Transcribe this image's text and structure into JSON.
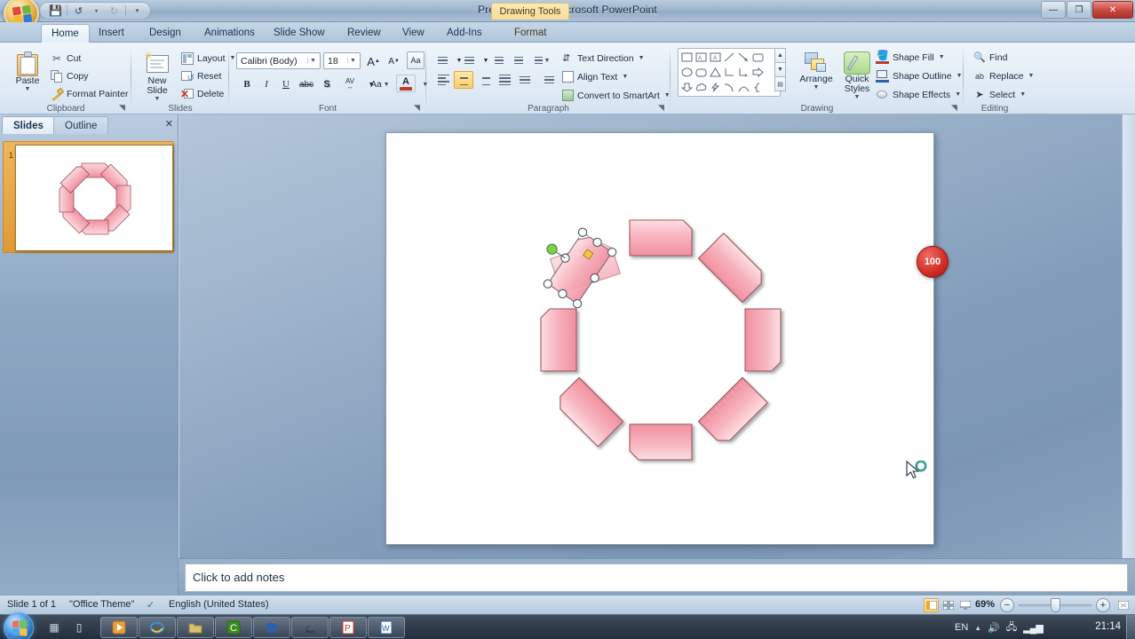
{
  "window": {
    "title": "Presentation2 - Microsoft PowerPoint",
    "contextual_tab_group": "Drawing Tools",
    "minimize": "—",
    "restore": "❐",
    "close": "✕"
  },
  "quick_access": {
    "save": "save-icon",
    "undo": "undo-icon",
    "redo": "redo-icon",
    "customize": "customize-icon"
  },
  "tabs": [
    {
      "label": "Home",
      "active": true
    },
    {
      "label": "Insert",
      "active": false
    },
    {
      "label": "Design",
      "active": false
    },
    {
      "label": "Animations",
      "active": false
    },
    {
      "label": "Slide Show",
      "active": false
    },
    {
      "label": "Review",
      "active": false
    },
    {
      "label": "View",
      "active": false
    },
    {
      "label": "Add-Ins",
      "active": false
    },
    {
      "label": "Format",
      "active": false,
      "contextual": true
    }
  ],
  "ribbon": {
    "clipboard": {
      "title": "Clipboard",
      "paste": "Paste",
      "cut": "Cut",
      "copy": "Copy",
      "format_painter": "Format Painter"
    },
    "slides": {
      "title": "Slides",
      "new_slide": "New Slide",
      "layout": "Layout",
      "reset": "Reset",
      "delete": "Delete"
    },
    "font": {
      "title": "Font",
      "font_family": "Calibri (Body)",
      "font_size": "18",
      "grow_font": "A",
      "shrink_font": "A",
      "clear_formatting": "Aa",
      "bold": "B",
      "italic": "I",
      "underline": "U",
      "strikethrough": "abc",
      "shadow": "S",
      "character_spacing": "AV",
      "change_case": "Aa",
      "font_color": "A"
    },
    "paragraph": {
      "title": "Paragraph",
      "text_direction": "Text Direction",
      "align_text": "Align Text",
      "convert_to_smartart": "Convert to SmartArt"
    },
    "drawing": {
      "title": "Drawing",
      "arrange": "Arrange",
      "quick_styles": "Quick Styles",
      "shape_fill": "Shape Fill",
      "shape_outline": "Shape Outline",
      "shape_effects": "Shape Effects"
    },
    "editing": {
      "title": "Editing",
      "find": "Find",
      "replace": "Replace",
      "select": "Select"
    }
  },
  "left_panel": {
    "tab_slides": "Slides",
    "tab_outline": "Outline",
    "close": "✕",
    "slide_number": "1"
  },
  "slide": {
    "shape_count": 8,
    "shape_fill_top": "#fbd3d7",
    "shape_fill_bottom": "#f3919f",
    "shape_outline": "#9c5462",
    "selected_shape_index": 7,
    "handles": {
      "rotate_color": "#7dd04a",
      "resize_color": "#ffffff",
      "adjust_color": "#f5c542"
    }
  },
  "notes": {
    "placeholder": "Click to add notes"
  },
  "status": {
    "slide_indicator": "Slide 1 of 1",
    "theme": "\"Office Theme\"",
    "spellcheck": "spellcheck-icon",
    "language": "English (United States)",
    "view_normal": "normal-view-icon",
    "view_sorter": "slide-sorter-icon",
    "view_show": "slideshow-icon",
    "zoom_level": "69%",
    "zoom_out": "−",
    "zoom_in": "+",
    "fit_to_window": "fit-window-icon"
  },
  "zoom_badge": {
    "value": "100"
  },
  "taskbar": {
    "start": "start-orb",
    "quick_launch": [
      "show-desktop-icon",
      "window-switcher-icon"
    ],
    "buttons": [
      {
        "name": "media-player"
      },
      {
        "name": "internet-explorer"
      },
      {
        "name": "windows-explorer"
      },
      {
        "name": "camtasia"
      },
      {
        "name": "firefox"
      },
      {
        "name": "c-app"
      },
      {
        "name": "powerpoint"
      },
      {
        "name": "word"
      }
    ],
    "tray": {
      "language": "EN",
      "show_hidden": "▲",
      "volume": "volume-icon",
      "network": "network-icon",
      "signal": "signal-icon",
      "clock": "21:14"
    }
  }
}
